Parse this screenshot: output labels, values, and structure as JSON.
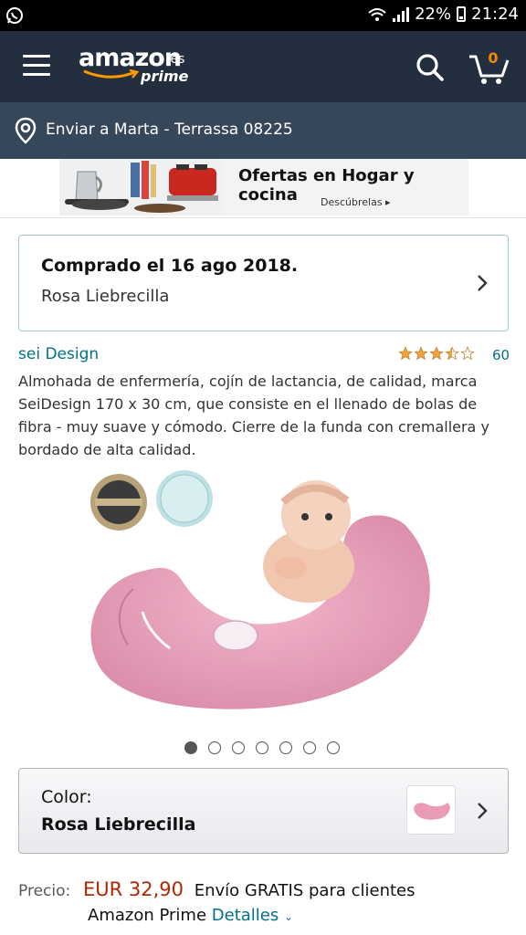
{
  "status_bar": {
    "battery": "22%",
    "time": "21:24"
  },
  "header": {
    "logo": {
      "word": "amazon",
      "suffix": ".es",
      "prime": "prime"
    },
    "cart_count": "0"
  },
  "deliver": {
    "text": "Enviar a Marta - Terrassa 08225"
  },
  "banner": {
    "title": "Ofertas en Hogar y cocina",
    "subtitle": "Descúbrelas ▸"
  },
  "purchased": {
    "title": "Comprado el 16 ago 2018.",
    "subtitle": "Rosa Liebrecilla"
  },
  "product": {
    "brand": "sei Design",
    "rating": 3.5,
    "rating_max": 5,
    "rating_count": "60",
    "description": "Almohada de enfermería, cojín de lactancia, de calidad, marca SeiDesign 170 x 30 cm, que consiste en el llenado de bolas de fibra - muy suave y cómodo. Cierre de la funda con cremallera y bordado de alta calidad.",
    "image_count": 7,
    "active_image": 0
  },
  "color_selector": {
    "label": "Color:",
    "value": "Rosa Liebrecilla"
  },
  "price": {
    "label": "Precio:",
    "amount": "EUR 32,90",
    "shipping": "Envío GRATIS para clientes",
    "line2": "Amazon Prime",
    "details_link": "Detalles"
  },
  "colors": {
    "header_bg": "#232f3e",
    "deliver_bg": "#37475a",
    "price": "#b12704",
    "link": "#007185",
    "star": "#f1a43c",
    "cart_badge": "#f08804"
  }
}
